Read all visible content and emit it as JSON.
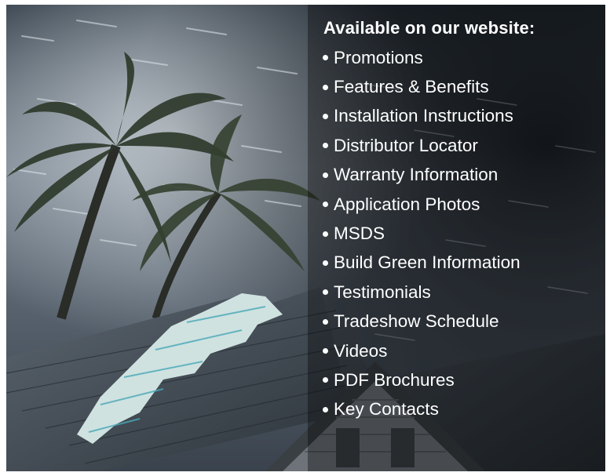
{
  "promo": {
    "heading": "Available on our website:",
    "items": [
      {
        "label": "Promotions"
      },
      {
        "label": "Features & Benefits"
      },
      {
        "label": "Installation Instructions"
      },
      {
        "label": "Distributor Locator"
      },
      {
        "label": "Warranty Information"
      },
      {
        "label": "Application Photos"
      },
      {
        "label": "MSDS"
      },
      {
        "label": "Build Green Information"
      },
      {
        "label": "Testimonials"
      },
      {
        "label": "Tradeshow Schedule"
      },
      {
        "label": "Videos"
      },
      {
        "label": "PDF Brochures"
      },
      {
        "label": "Key Contacts"
      }
    ]
  },
  "photo": {
    "subject": "storm-damaged-roof-with-palm-trees"
  }
}
